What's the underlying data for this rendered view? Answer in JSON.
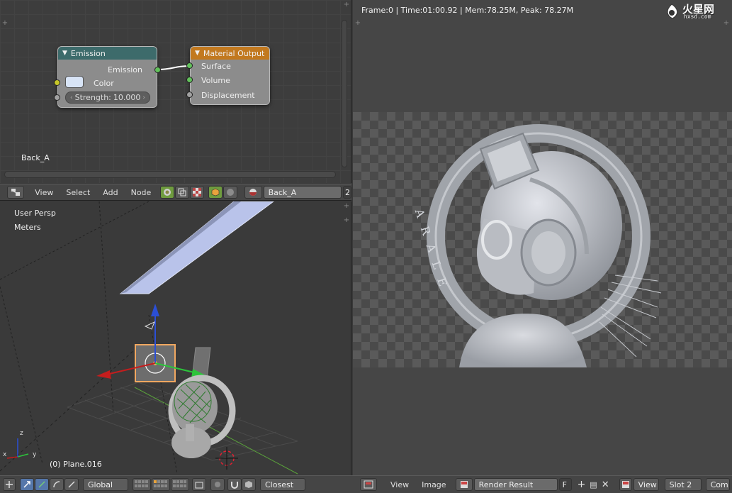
{
  "node_editor": {
    "material_name": "Back_A",
    "emission_node": {
      "title": "Emission",
      "output_label": "Emission",
      "color_label": "Color",
      "strength_label": "Strength:",
      "strength_value": "10.000",
      "header_color": "#3d6b6b"
    },
    "output_node": {
      "title": "Material Output",
      "inputs": [
        "Surface",
        "Volume",
        "Displacement"
      ],
      "header_color": "#c2791f"
    },
    "header": {
      "menu": [
        "View",
        "Select",
        "Add",
        "Node"
      ],
      "material_field": "Back_A",
      "users_count": "2"
    }
  },
  "viewport": {
    "persp_label": "User Persp",
    "units_label": "Meters",
    "object_label": "(0) Plane.016",
    "axis_x": "x",
    "axis_y": "y",
    "axis_z": "z",
    "header": {
      "orientation": "Global",
      "snap_target": "Closest"
    }
  },
  "image_editor": {
    "stats": "Frame:0 | Time:01:00.92 | Mem:78.25M, Peak: 78.27M",
    "watermark_text": "火星网",
    "watermark_sub": "hxsd.com",
    "render_text": "ARALE",
    "header": {
      "menu": [
        "View",
        "Image"
      ],
      "image_name": "Render Result",
      "fake_user": "F",
      "view_label": "View",
      "slot_label": "Slot 2",
      "composite_label": "Com"
    }
  }
}
